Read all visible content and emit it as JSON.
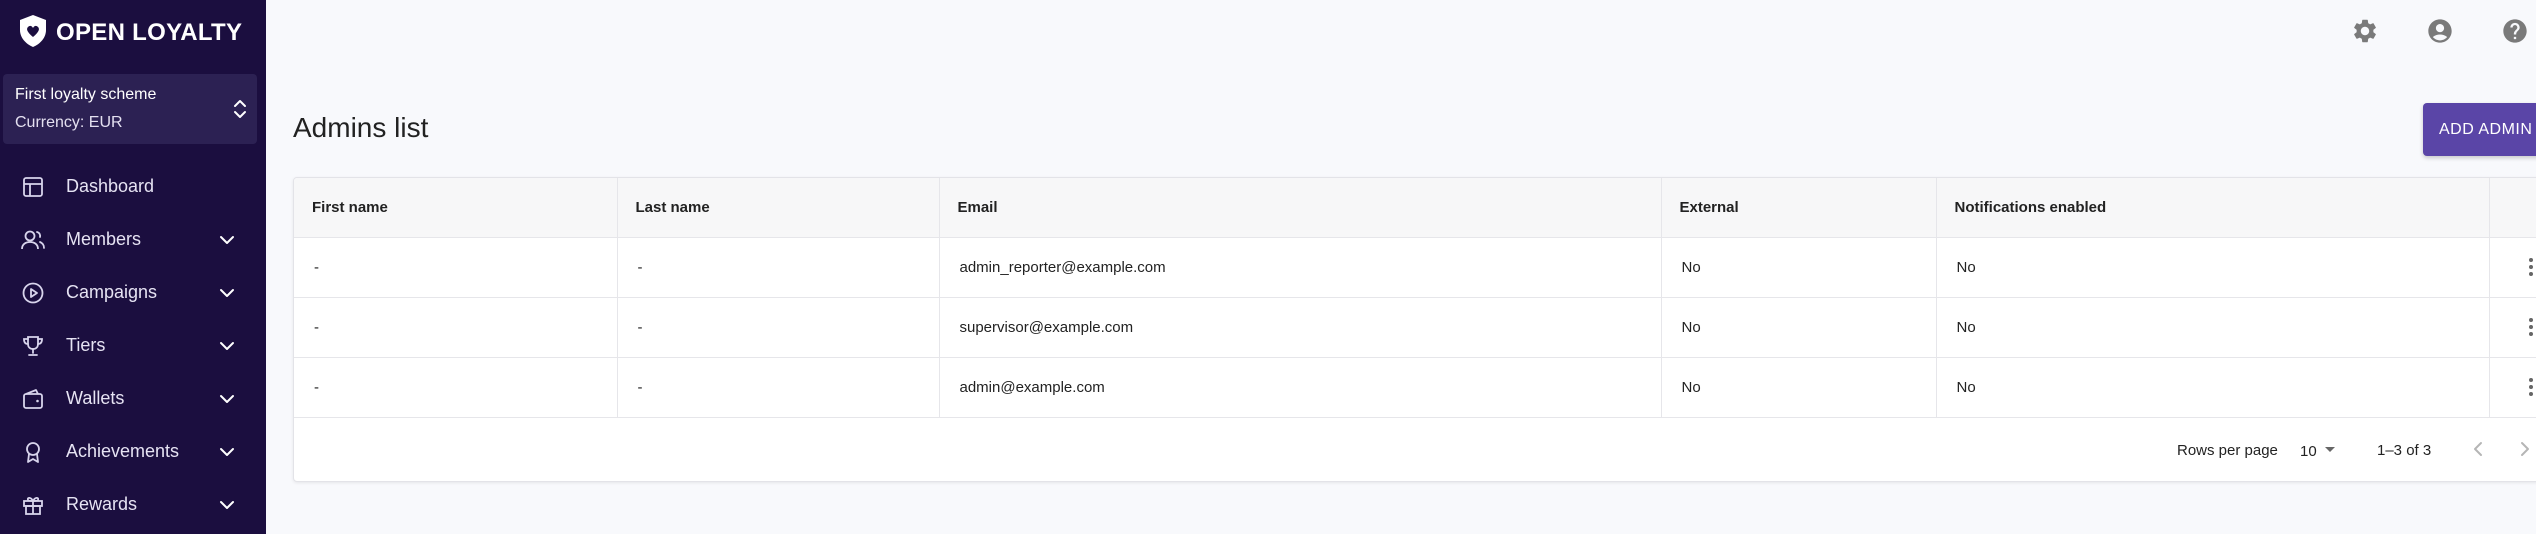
{
  "brand": {
    "name": "OPEN LOYALTY",
    "accent": "#5a45a7",
    "sidebar_bg": "#1b0e3f"
  },
  "scheme": {
    "name": "First loyalty scheme",
    "currency": "Currency: EUR"
  },
  "sidebar": {
    "items": [
      {
        "label": "Dashboard",
        "icon": "dashboard-icon",
        "expandable": false
      },
      {
        "label": "Members",
        "icon": "members-icon",
        "expandable": true
      },
      {
        "label": "Campaigns",
        "icon": "campaigns-icon",
        "expandable": true
      },
      {
        "label": "Tiers",
        "icon": "trophy-icon",
        "expandable": true
      },
      {
        "label": "Wallets",
        "icon": "wallet-icon",
        "expandable": true
      },
      {
        "label": "Achievements",
        "icon": "award-icon",
        "expandable": true
      },
      {
        "label": "Rewards",
        "icon": "gift-icon",
        "expandable": true
      }
    ]
  },
  "topbar": {
    "icons": [
      "settings-icon",
      "account-icon",
      "help-icon"
    ]
  },
  "page": {
    "title": "Admins list",
    "add_button": "ADD ADMIN"
  },
  "table": {
    "columns": [
      "First name",
      "Last name",
      "Email",
      "External",
      "Notifications enabled"
    ],
    "rows": [
      {
        "first_name": "-",
        "last_name": "-",
        "email": "admin_reporter@example.com",
        "external": "No",
        "notifications": "No"
      },
      {
        "first_name": "-",
        "last_name": "-",
        "email": "supervisor@example.com",
        "external": "No",
        "notifications": "No"
      },
      {
        "first_name": "-",
        "last_name": "-",
        "email": "admin@example.com",
        "external": "No",
        "notifications": "No"
      }
    ]
  },
  "pagination": {
    "rows_per_page_label": "Rows per page",
    "rows_per_page": "10",
    "range": "1–3 of 3"
  }
}
